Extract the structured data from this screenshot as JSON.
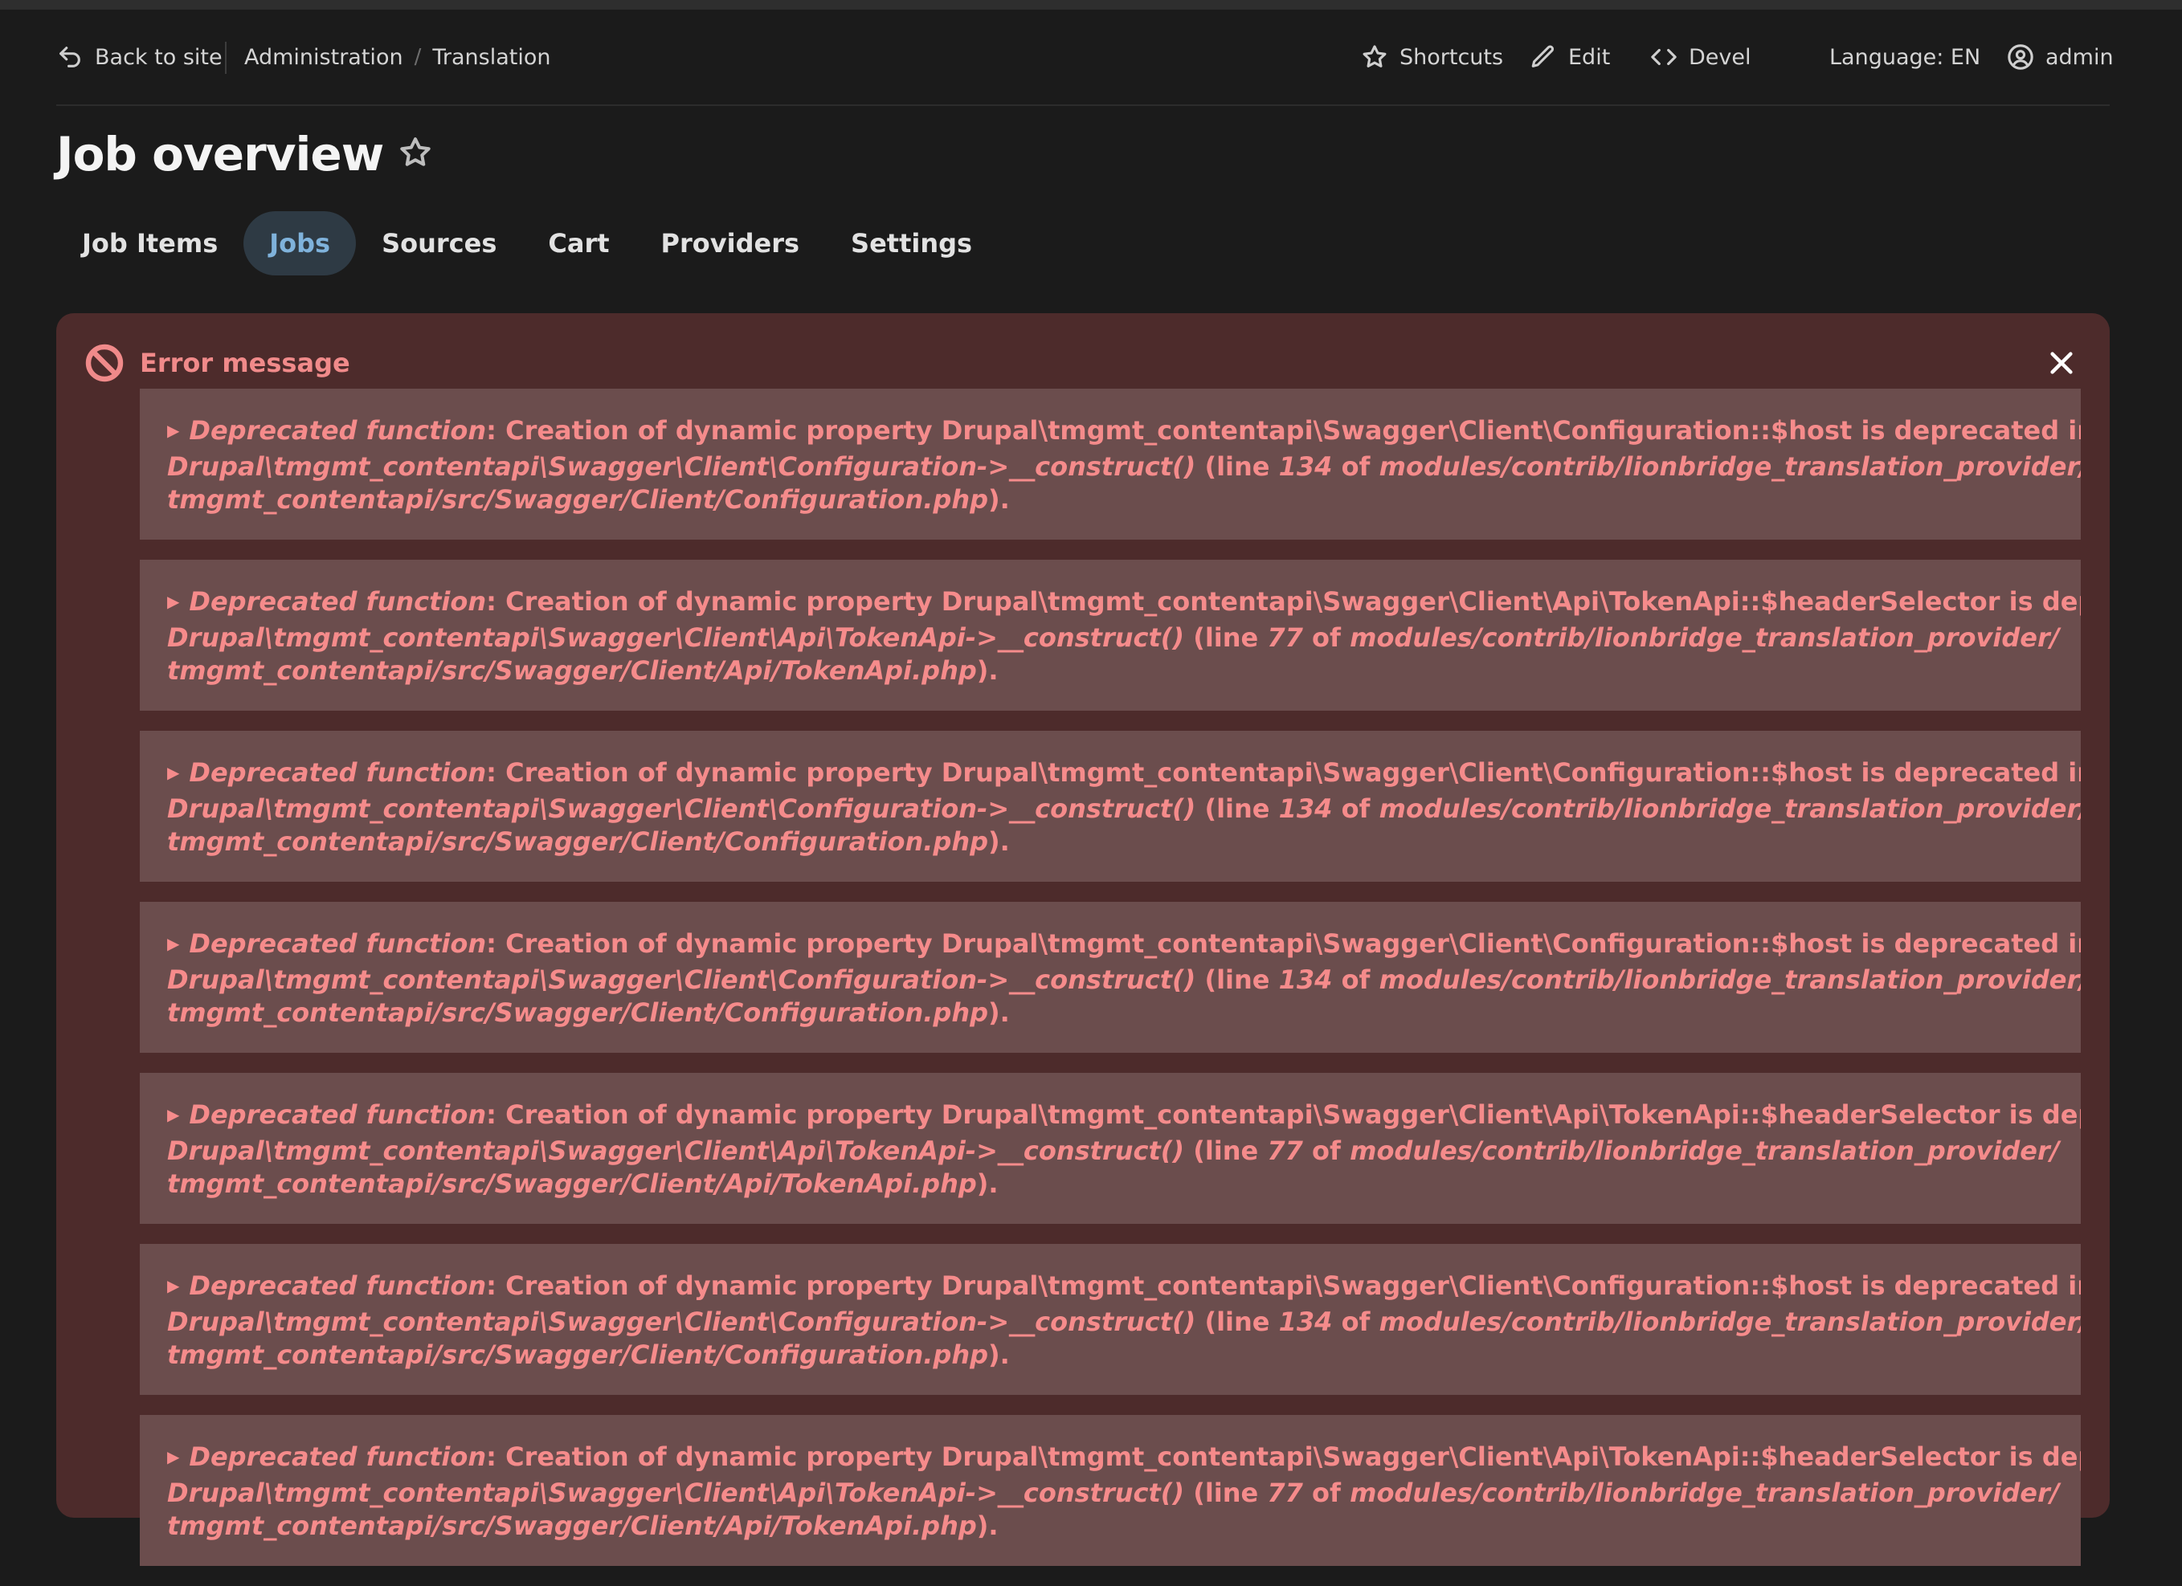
{
  "toolbar": {
    "back_label": "Back to site",
    "breadcrumb": [
      "Administration",
      "Translation"
    ],
    "breadcrumb_separator": "/",
    "shortcuts_label": "Shortcuts",
    "edit_label": "Edit",
    "devel_label": "Devel",
    "language_label": "Language: EN",
    "user_label": "admin"
  },
  "page": {
    "title": "Job overview"
  },
  "tabs": [
    {
      "label": "Job Items",
      "active": false
    },
    {
      "label": "Jobs",
      "active": true
    },
    {
      "label": "Sources",
      "active": false
    },
    {
      "label": "Cart",
      "active": false
    },
    {
      "label": "Providers",
      "active": false
    },
    {
      "label": "Settings",
      "active": false
    }
  ],
  "error": {
    "title": "Error message",
    "messages": [
      {
        "type": "Deprecated function",
        "message": ": Creation of dynamic property Drupal\\tmgmt_contentapi\\Swagger\\Client\\Configuration::$host is deprecated in",
        "function": "Drupal\\tmgmt_contentapi\\Swagger\\Client\\Configuration->__construct()",
        "line_prefix": " (line ",
        "line": "134",
        "of_text": " of ",
        "path_line1": "modules/contrib/lionbridge_translation_provider/",
        "path_line2": "tmgmt_contentapi/src/Swagger/Client/Configuration.php",
        "end": ")."
      },
      {
        "type": "Deprecated function",
        "message": ": Creation of dynamic property Drupal\\tmgmt_contentapi\\Swagger\\Client\\Api\\TokenApi::$headerSelector is deprecated in",
        "function": "Drupal\\tmgmt_contentapi\\Swagger\\Client\\Api\\TokenApi->__construct()",
        "line_prefix": " (line ",
        "line": "77",
        "of_text": " of ",
        "path_line1": "modules/contrib/lionbridge_translation_provider/",
        "path_line2": "tmgmt_contentapi/src/Swagger/Client/Api/TokenApi.php",
        "end": ")."
      },
      {
        "type": "Deprecated function",
        "message": ": Creation of dynamic property Drupal\\tmgmt_contentapi\\Swagger\\Client\\Configuration::$host is deprecated in",
        "function": "Drupal\\tmgmt_contentapi\\Swagger\\Client\\Configuration->__construct()",
        "line_prefix": " (line ",
        "line": "134",
        "of_text": " of ",
        "path_line1": "modules/contrib/lionbridge_translation_provider/",
        "path_line2": "tmgmt_contentapi/src/Swagger/Client/Configuration.php",
        "end": ")."
      },
      {
        "type": "Deprecated function",
        "message": ": Creation of dynamic property Drupal\\tmgmt_contentapi\\Swagger\\Client\\Configuration::$host is deprecated in",
        "function": "Drupal\\tmgmt_contentapi\\Swagger\\Client\\Configuration->__construct()",
        "line_prefix": " (line ",
        "line": "134",
        "of_text": " of ",
        "path_line1": "modules/contrib/lionbridge_translation_provider/",
        "path_line2": "tmgmt_contentapi/src/Swagger/Client/Configuration.php",
        "end": ")."
      },
      {
        "type": "Deprecated function",
        "message": ": Creation of dynamic property Drupal\\tmgmt_contentapi\\Swagger\\Client\\Api\\TokenApi::$headerSelector is deprecated in",
        "function": "Drupal\\tmgmt_contentapi\\Swagger\\Client\\Api\\TokenApi->__construct()",
        "line_prefix": " (line ",
        "line": "77",
        "of_text": " of ",
        "path_line1": "modules/contrib/lionbridge_translation_provider/",
        "path_line2": "tmgmt_contentapi/src/Swagger/Client/Api/TokenApi.php",
        "end": ")."
      },
      {
        "type": "Deprecated function",
        "message": ": Creation of dynamic property Drupal\\tmgmt_contentapi\\Swagger\\Client\\Configuration::$host is deprecated in",
        "function": "Drupal\\tmgmt_contentapi\\Swagger\\Client\\Configuration->__construct()",
        "line_prefix": " (line ",
        "line": "134",
        "of_text": " of ",
        "path_line1": "modules/contrib/lionbridge_translation_provider/",
        "path_line2": "tmgmt_contentapi/src/Swagger/Client/Configuration.php",
        "end": ")."
      },
      {
        "type": "Deprecated function",
        "message": ": Creation of dynamic property Drupal\\tmgmt_contentapi\\Swagger\\Client\\Api\\TokenApi::$headerSelector is deprecated in",
        "function": "Drupal\\tmgmt_contentapi\\Swagger\\Client\\Api\\TokenApi->__construct()",
        "line_prefix": " (line ",
        "line": "77",
        "of_text": " of ",
        "path_line1": "modules/contrib/lionbridge_translation_provider/",
        "path_line2": "tmgmt_contentapi/src/Swagger/Client/Api/TokenApi.php",
        "end": ")."
      }
    ]
  },
  "colors": {
    "background": "#1b1b1b",
    "error_panel": "#4d2b2b",
    "error_item": "#6b4d4d",
    "error_text": "#f58b8b",
    "active_tab_bg": "#2e3a44",
    "active_tab_text": "#7fb2db"
  }
}
